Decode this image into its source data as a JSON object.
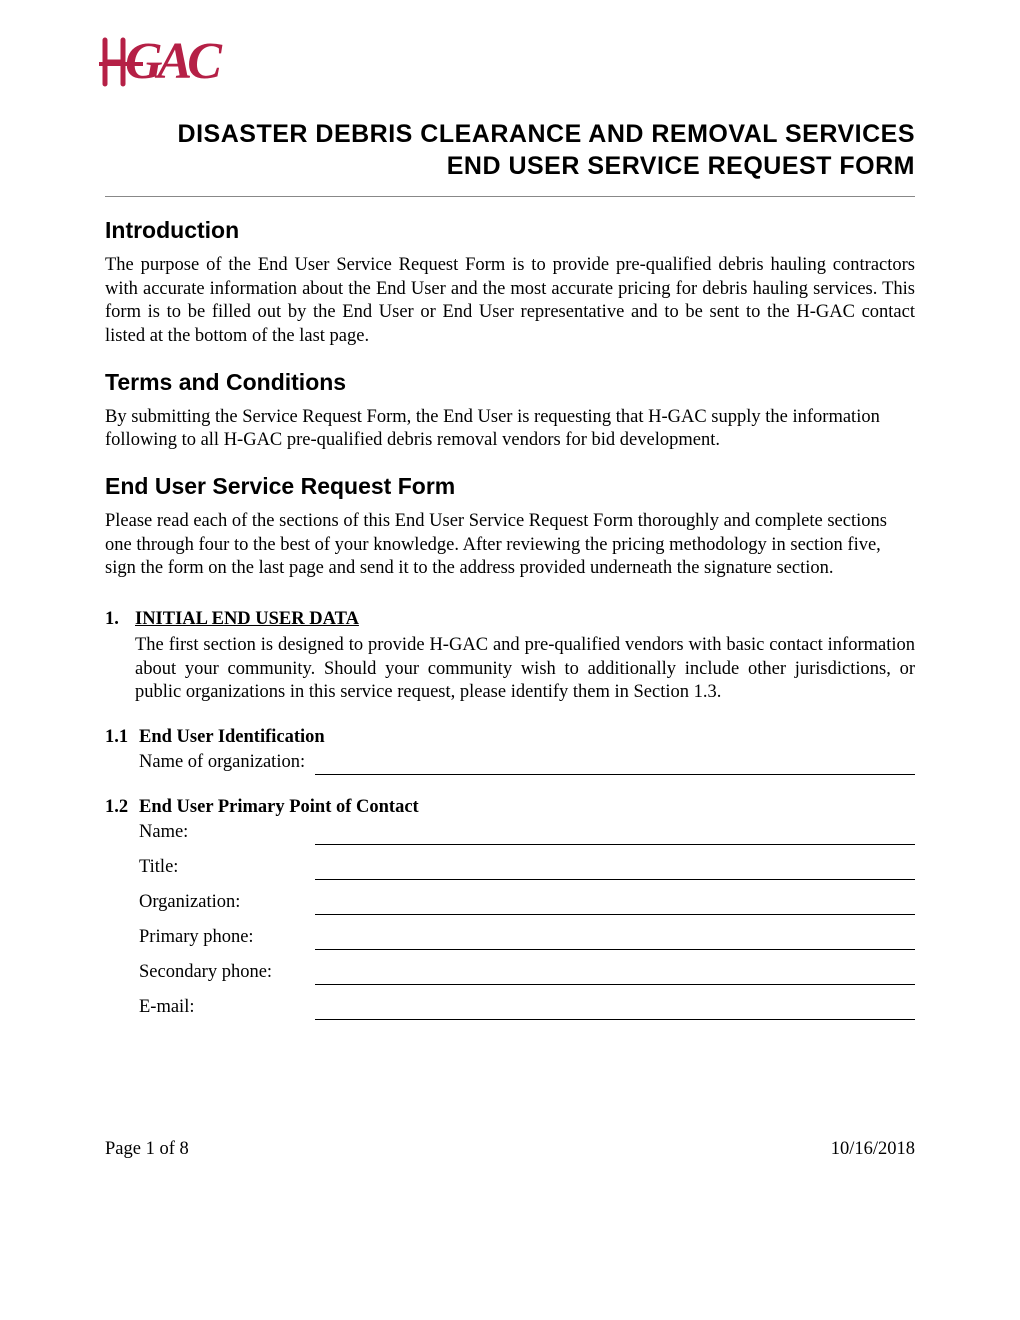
{
  "logo_alt": "h-GAC",
  "brand_color": "#b52046",
  "title_line1": "DISASTER DEBRIS CLEARANCE AND REMOVAL SERVICES",
  "title_line2": "END USER SERVICE REQUEST FORM",
  "sections": {
    "intro": {
      "heading": "Introduction",
      "text": "The purpose of the End User Service Request Form is to provide pre-qualified debris hauling contractors with accurate information about the End User and the most accurate pricing for debris hauling services. This form is to be filled out by the End User or End User representative and to be sent to the H-GAC contact listed at the bottom of the last page."
    },
    "terms": {
      "heading": "Terms and Conditions",
      "text": "By submitting the Service Request Form, the End User is requesting that H-GAC supply the information following to all H-GAC pre-qualified debris removal vendors for bid development."
    },
    "form": {
      "heading": "End User Service Request Form",
      "text": "Please read each of the sections of this End User Service Request Form thoroughly and complete sections one through four to the best of your knowledge. After reviewing the pricing methodology in section five, sign the form on the last page and send it to the address provided underneath the signature section."
    }
  },
  "section1": {
    "number": "1.",
    "title": "INITIAL END USER DATA",
    "body": "The first section is designed to provide H-GAC and pre-qualified vendors with basic contact information about your community. Should your community wish to additionally include other jurisdictions, or public organizations in this service request, please identify them in Section 1.3."
  },
  "sub11": {
    "number": "1.1",
    "title": "End User Identification",
    "fields": [
      {
        "label": "Name of organization:",
        "value": ""
      }
    ]
  },
  "sub12": {
    "number": "1.2",
    "title": "End User Primary Point of Contact",
    "fields": [
      {
        "label": "Name:",
        "value": ""
      },
      {
        "label": "Title:",
        "value": ""
      },
      {
        "label": "Organization:",
        "value": ""
      },
      {
        "label": "Primary phone:",
        "value": ""
      },
      {
        "label": "Secondary phone:",
        "value": ""
      },
      {
        "label": "E-mail:",
        "value": ""
      }
    ]
  },
  "footer": {
    "page": "Page 1 of 8",
    "date": "10/16/2018"
  }
}
